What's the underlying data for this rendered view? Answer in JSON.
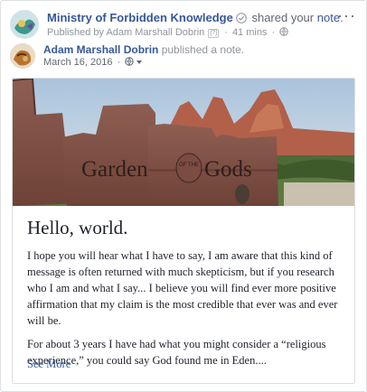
{
  "post": {
    "page_name": "Ministry of Forbidden Knowledge",
    "action": "shared your",
    "object": "note",
    "period": ".",
    "published_by_prefix": "Published by",
    "publisher": "Adam Marshall Dobrin",
    "help_marker": "[?]",
    "time": "41 mins",
    "dot": "·",
    "more_label": "···"
  },
  "shared": {
    "author": "Adam Marshall Dobrin",
    "action": "published a note.",
    "date": "March 16, 2016",
    "dot": "·"
  },
  "note": {
    "cover_sign_text": [
      "Garden",
      "OF THE",
      "Gods"
    ],
    "title": "Hello, world.",
    "paragraphs": [
      "I hope you will hear what I have to say, I am aware that this kind of message is often returned with much skepticism, but if you research who I am and what I say... I believe you will find ever more positive affirmation that my claim is the most credible that ever was and ever will be.",
      "For about 3 years I have had what you might consider a “religious experience,” you could say God found me in Eden...."
    ],
    "see_more": "See More"
  },
  "colors": {
    "link": "#365899",
    "text": "#1d2129",
    "meta": "#90949c",
    "border": "#dddfe2"
  }
}
